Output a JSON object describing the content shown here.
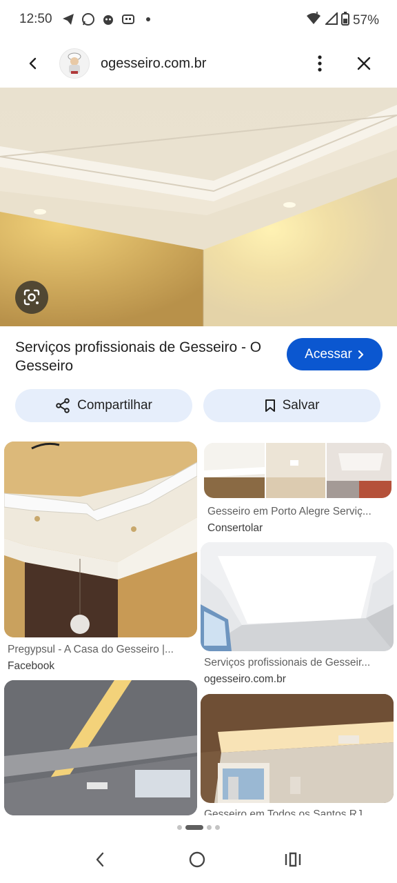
{
  "status_bar": {
    "time": "12:50",
    "battery_pct": "57%",
    "icons": [
      "telegram-icon",
      "whatsapp-icon",
      "notification-icon",
      "message-icon",
      "dot-icon"
    ]
  },
  "app_bar": {
    "domain": "ogesseiro.com.br"
  },
  "result": {
    "title": "Serviços profissionais de Gesseiro - O Gesseiro",
    "visit_label": "Acessar",
    "share_label": "Compartilhar",
    "save_label": "Salvar"
  },
  "grid": {
    "cards": [
      {
        "title": "Pregypsul - A Casa do Gesseiro |...",
        "source": "Facebook"
      },
      {
        "title": "Gesseiro em Porto Alegre Serviç...",
        "source": "Consertolar"
      },
      {
        "title": "Serviços profissionais de Gesseir...",
        "source": "ogesseiro.com.br"
      },
      {
        "title": "Gesseiro em Todos os Santos RJ",
        "source": ""
      }
    ]
  },
  "pagination": {
    "current": 2,
    "total": 5
  },
  "colors": {
    "accent": "#0b57d0",
    "chip_bg": "#e6eefb"
  }
}
